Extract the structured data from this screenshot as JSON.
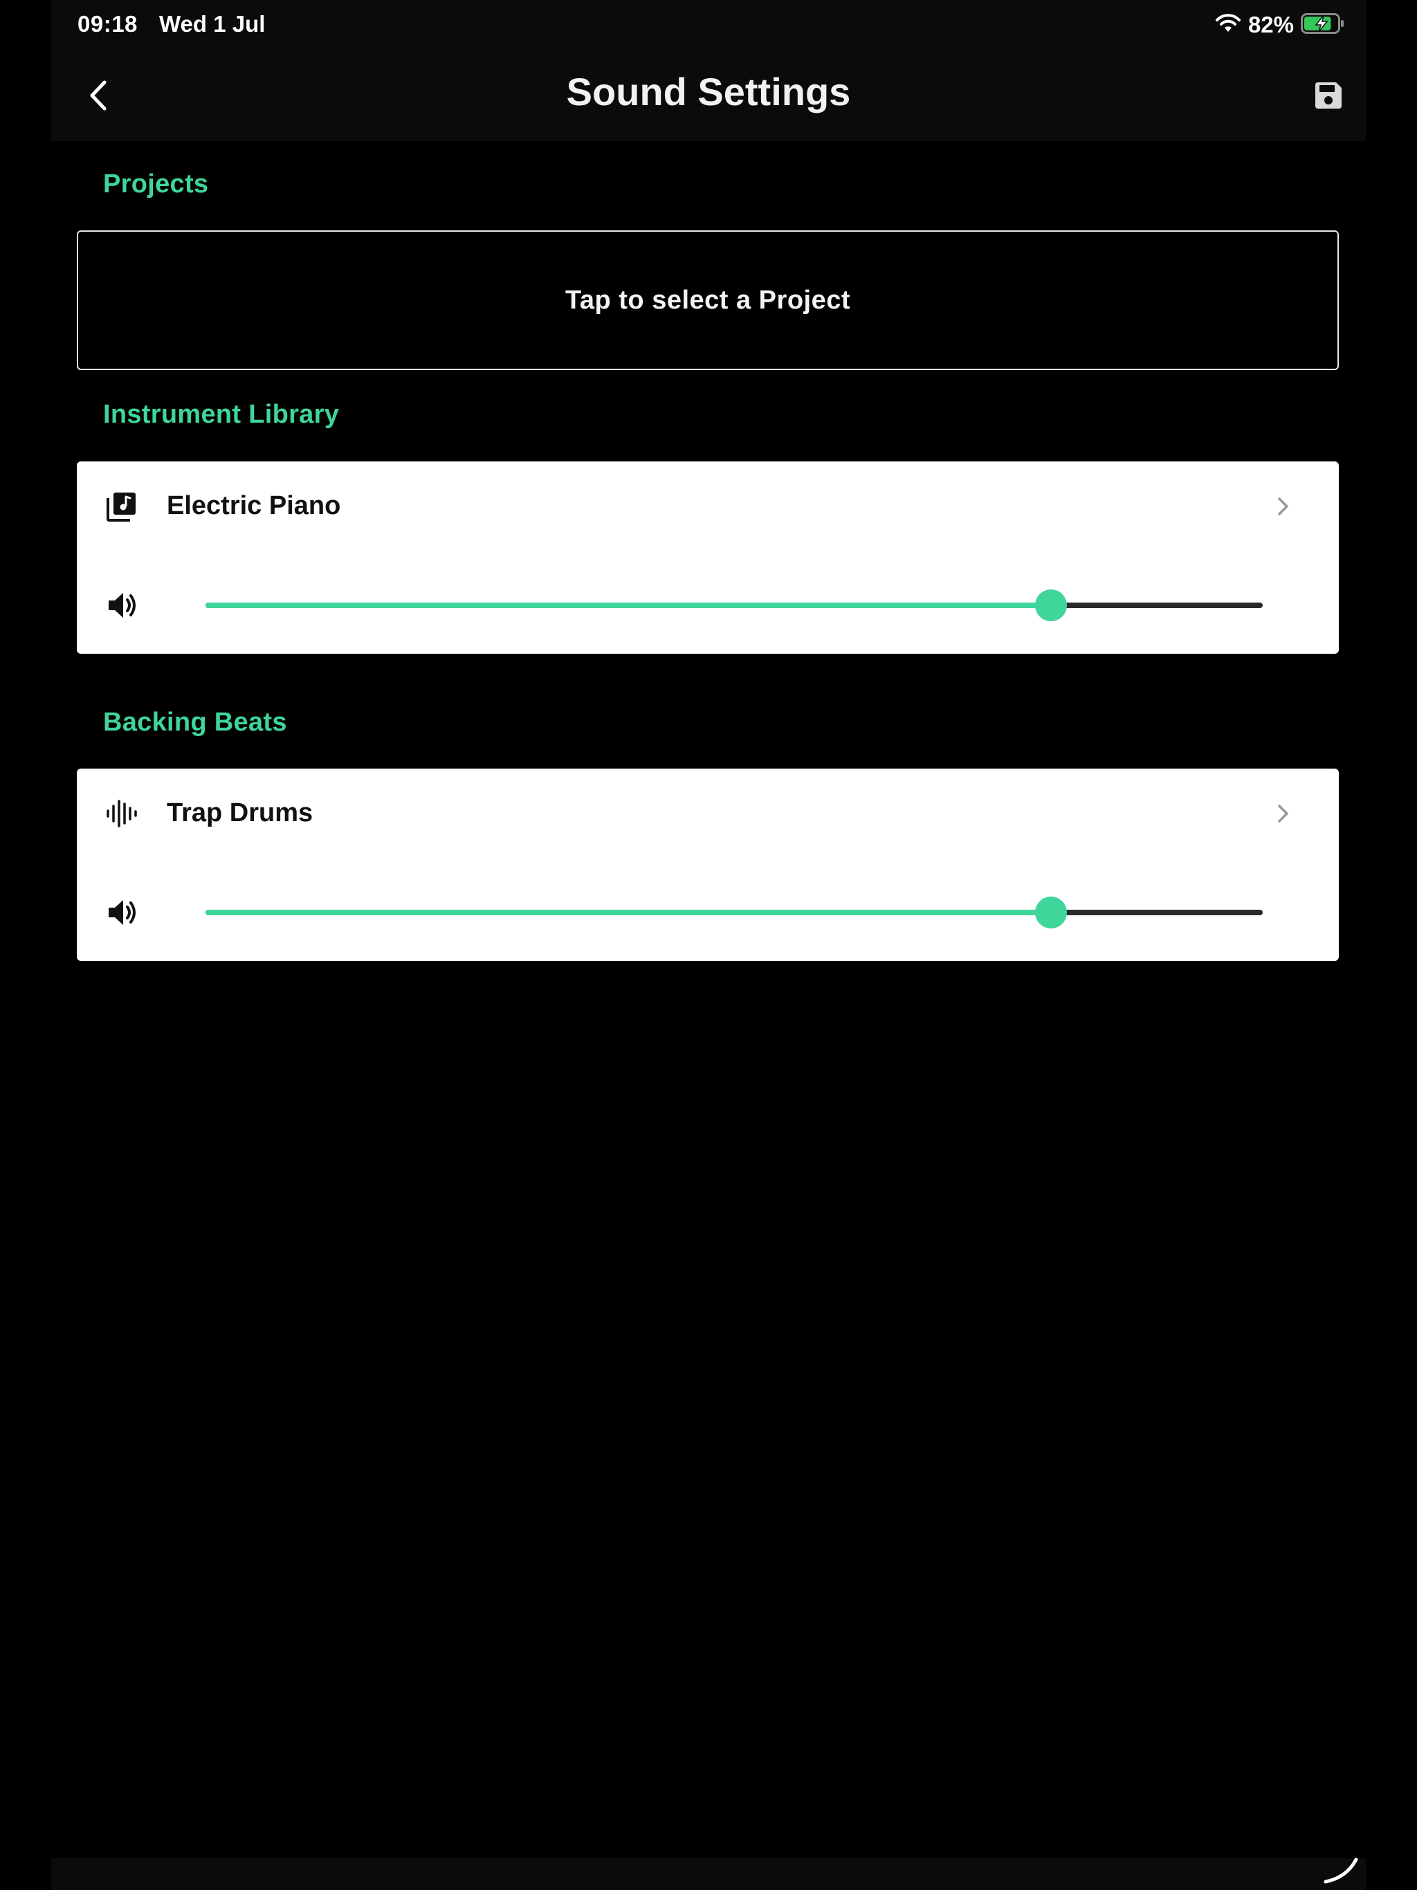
{
  "status_bar": {
    "time": "09:18",
    "date": "Wed 1 Jul",
    "battery_percent": "82%",
    "wifi_icon": "wifi-icon",
    "battery_icon": "battery-charging-icon",
    "battery_level": 0.82
  },
  "nav": {
    "title": "Sound Settings",
    "back_icon": "chevron-left-icon",
    "save_icon": "floppy-disk-icon"
  },
  "projects": {
    "heading": "Projects",
    "select_label": "Tap to select a Project"
  },
  "instrument_library": {
    "heading": "Instrument Library",
    "item_label": "Electric Piano",
    "item_icon": "music-library-icon",
    "volume_icon": "speaker-volume-icon",
    "volume_fraction": 0.8
  },
  "backing_beats": {
    "heading": "Backing Beats",
    "item_label": "Trap Drums",
    "item_icon": "waveform-icon",
    "volume_icon": "speaker-volume-icon",
    "volume_fraction": 0.8
  },
  "colors": {
    "accent": "#3fd59b",
    "background": "#000000",
    "card": "#ffffff"
  }
}
